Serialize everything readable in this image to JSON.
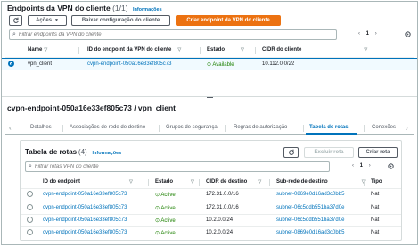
{
  "endpoints": {
    "title": "Endpoints da VPN do cliente",
    "count": "(1/1)",
    "info_link": "Informações",
    "actions_label": "Ações",
    "download_label": "Baixar configuração do cliente",
    "create_label": "Criar endpoint da VPN do cliente",
    "search_placeholder": "Filtrar endpoints da VPN do cliente",
    "page": "1",
    "columns": {
      "name": "Name",
      "id": "ID do endpoint da VPN do cliente",
      "status": "Estado",
      "cidr": "CIDR do cliente"
    },
    "row": {
      "name": "vpn_client",
      "id": "cvpn-endpoint-050a16e33ef805c73",
      "status": "Available",
      "cidr": "10.112.0.0/22"
    }
  },
  "details": {
    "title": "cvpn-endpoint-050a16e33ef805c73 / vpn_client",
    "tabs": [
      "Detalhes",
      "Associações de rede de destino",
      "Grupos de segurança",
      "Regras de autorização",
      "Tabela de rotas",
      "Conexões"
    ],
    "active_tab": "Tabela de rotas"
  },
  "routes": {
    "title": "Tabela de rotas",
    "count": "(4)",
    "info_link": "Informações",
    "delete_label": "Excluir rota",
    "create_label": "Criar rota",
    "search_placeholder": "Filtrar rotas VPN do cliente",
    "page": "1",
    "columns": {
      "id": "ID do endpoint",
      "status": "Estado",
      "cidr": "CIDR de destino",
      "subnet": "Sub-rede de destino",
      "type": "Tipo"
    },
    "rows": [
      {
        "id": "cvpn-endpoint-050a16e33ef805c73",
        "status": "Active",
        "cidr": "172.31.0.0/16",
        "subnet": "subnet-0869e0d16ad3c0bb5",
        "type": "Nat"
      },
      {
        "id": "cvpn-endpoint-050a16e33ef805c73",
        "status": "Active",
        "cidr": "172.31.0.0/16",
        "subnet": "subnet-06c5ddb551ba37d0e",
        "type": "Nat"
      },
      {
        "id": "cvpn-endpoint-050a16e33ef805c73",
        "status": "Active",
        "cidr": "10.2.0.0/24",
        "subnet": "subnet-06c5ddb551ba37d0e",
        "type": "Nat"
      },
      {
        "id": "cvpn-endpoint-050a16e33ef805c73",
        "status": "Active",
        "cidr": "10.2.0.0/24",
        "subnet": "subnet-0869e0d16ad3c0bb5",
        "type": "Nat"
      }
    ]
  },
  "colors": {
    "accent": "#0073bb",
    "primary": "#ec7211",
    "success": "#1d8102"
  }
}
